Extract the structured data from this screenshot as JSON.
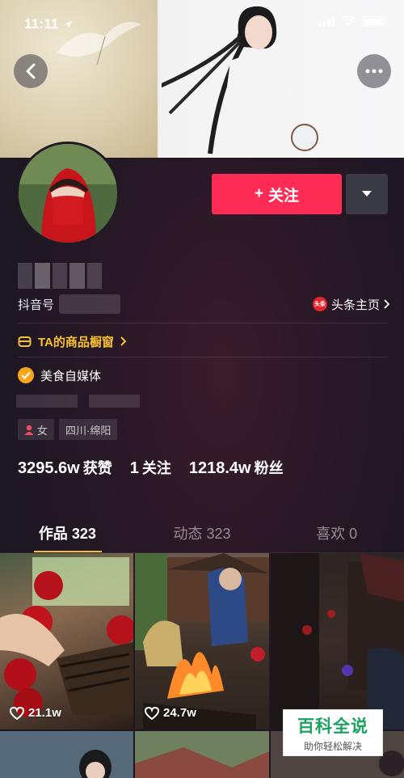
{
  "status_bar": {
    "time": "11:11"
  },
  "header": {
    "back_icon": "chevron-left-icon",
    "more_icon": "ellipsis-icon"
  },
  "profile": {
    "follow_label": "关注",
    "follow_prefix": "+",
    "id_label": "抖音号",
    "toutiao_label": "头条主页",
    "toutiao_badge": "头条",
    "shop_label": "TA的商品橱窗",
    "verified_label": "美食自媒体",
    "tags": {
      "gender": "女",
      "location": "四川·绵阳"
    },
    "stats": {
      "likes_value": "3295.6w",
      "likes_label": "获赞",
      "following_value": "1",
      "following_label": "关注",
      "followers_value": "1218.4w",
      "followers_label": "粉丝"
    }
  },
  "tabs": [
    {
      "label": "作品 323"
    },
    {
      "label": "动态 323"
    },
    {
      "label": "喜欢 0"
    }
  ],
  "videos": [
    {
      "likes": "21.1w"
    },
    {
      "likes": "24.7w"
    },
    {
      "likes": ""
    }
  ],
  "watermark": {
    "title": "百科全说",
    "subtitle": "助你轻松解决"
  },
  "colors": {
    "accent": "#fe2c55",
    "gold": "#f8c02f",
    "background": "#161823"
  }
}
